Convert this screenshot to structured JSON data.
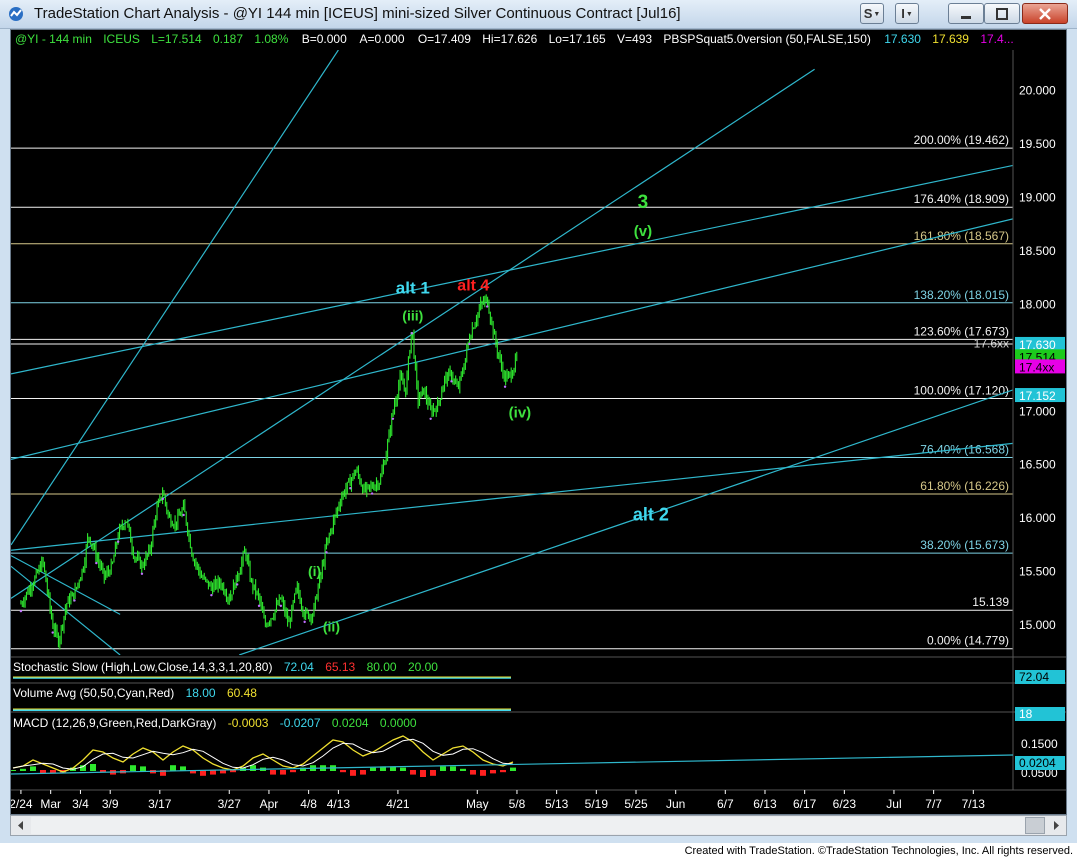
{
  "window": {
    "title": "TradeStation Chart Analysis - @YI 144 min [ICEUS] mini-sized Silver Continuous Contract [Jul16]",
    "buttons": [
      "S",
      "I"
    ],
    "credit": "Created with TradeStation. ©TradeStation Technologies, Inc. All rights reserved."
  },
  "header": {
    "symbol": "@YI - 144 min",
    "exchange": "ICEUS",
    "last": "L=17.514",
    "change": "0.187",
    "pct": "1.08%",
    "bid": "B=0.000",
    "ask": "A=0.000",
    "open": "O=17.409",
    "high": "Hi=17.626",
    "low": "Lo=17.165",
    "volume": "V=493",
    "indicator": "PBSPSquat5.0version (50,FALSE,150)",
    "ind_v1": "17.630",
    "ind_v2": "17.639",
    "ind_v3": "17.4..."
  },
  "chart_data": {
    "type": "candlestick",
    "symbol": "@YI",
    "interval": "144 min",
    "ylim": [
      14.72,
      20.38
    ],
    "y_ticks": [
      15.0,
      15.5,
      16.0,
      16.5,
      17.0,
      17.5,
      18.0,
      18.5,
      19.0,
      19.5,
      20.0
    ],
    "y_tick_labels": [
      "15.000",
      "15.500",
      "16.000",
      "16.500",
      "17.000",
      "17.500",
      "18.000",
      "18.500",
      "19.000",
      "19.500",
      "20.000"
    ],
    "x_labels": [
      "2/24",
      "Mar",
      "3/4",
      "3/9",
      "3/17",
      "3/27",
      "Apr",
      "4/8",
      "4/13",
      "4/21",
      "May",
      "5/8",
      "5/13",
      "5/19",
      "5/25",
      "Jun",
      "6/7",
      "6/13",
      "6/17",
      "6/23",
      "Jul",
      "7/7",
      "7/13"
    ],
    "x_label_day_index": [
      0,
      3,
      6,
      9,
      14,
      21,
      25,
      29,
      32,
      38,
      46,
      50,
      54,
      58,
      62,
      66,
      71,
      75,
      79,
      83,
      88,
      92,
      96
    ],
    "x_day_span": [
      -1,
      100
    ],
    "price_path": [
      [
        0,
        15.2
      ],
      [
        1.5,
        15.45
      ],
      [
        2.2,
        15.6
      ],
      [
        3.2,
        15.0
      ],
      [
        3.8,
        14.85
      ],
      [
        4.6,
        15.2
      ],
      [
        5.4,
        15.3
      ],
      [
        6.3,
        15.55
      ],
      [
        6.8,
        15.85
      ],
      [
        7.6,
        15.65
      ],
      [
        8.4,
        15.45
      ],
      [
        9.2,
        15.55
      ],
      [
        9.8,
        15.85
      ],
      [
        10.6,
        16.0
      ],
      [
        11.4,
        15.65
      ],
      [
        12.2,
        15.55
      ],
      [
        13,
        15.7
      ],
      [
        13.6,
        16.05
      ],
      [
        14.3,
        16.25
      ],
      [
        14.9,
        16.0
      ],
      [
        15.6,
        15.95
      ],
      [
        16.4,
        16.1
      ],
      [
        17.3,
        15.65
      ],
      [
        18.2,
        15.45
      ],
      [
        19.2,
        15.35
      ],
      [
        20.1,
        15.4
      ],
      [
        21,
        15.25
      ],
      [
        21.8,
        15.45
      ],
      [
        22.6,
        15.7
      ],
      [
        23.2,
        15.4
      ],
      [
        24,
        15.25
      ],
      [
        24.6,
        15.0
      ],
      [
        25.4,
        15.1
      ],
      [
        26.2,
        15.25
      ],
      [
        27,
        15.0
      ],
      [
        27.8,
        15.35
      ],
      [
        28.6,
        15.1
      ],
      [
        29.4,
        15.1
      ],
      [
        30.2,
        15.45
      ],
      [
        30.8,
        15.75
      ],
      [
        31.6,
        16.0
      ],
      [
        32.3,
        16.2
      ],
      [
        33.2,
        16.35
      ],
      [
        33.8,
        16.45
      ],
      [
        34.6,
        16.25
      ],
      [
        35.4,
        16.3
      ],
      [
        36.2,
        16.35
      ],
      [
        36.8,
        16.6
      ],
      [
        37.5,
        17.0
      ],
      [
        38.2,
        17.3
      ],
      [
        38.8,
        17.2
      ],
      [
        39.4,
        17.8
      ],
      [
        40,
        17.1
      ],
      [
        40.6,
        17.2
      ],
      [
        41.3,
        17.0
      ],
      [
        42,
        17.05
      ],
      [
        42.7,
        17.3
      ],
      [
        43.4,
        17.35
      ],
      [
        44,
        17.2
      ],
      [
        44.6,
        17.4
      ],
      [
        45.2,
        17.7
      ],
      [
        45.8,
        17.85
      ],
      [
        46.4,
        18.0
      ],
      [
        47,
        18.05
      ],
      [
        47.6,
        17.75
      ],
      [
        48.2,
        17.5
      ],
      [
        48.8,
        17.3
      ],
      [
        49.4,
        17.35
      ],
      [
        50,
        17.5
      ]
    ],
    "fib_levels": [
      {
        "price": 19.462,
        "label": "200.00% (19.462)",
        "color": "#f2f2f2"
      },
      {
        "price": 18.909,
        "label": "176.40% (18.909)",
        "color": "#f2f2f2"
      },
      {
        "price": 18.567,
        "label": "161.80% (18.567)",
        "color": "#d6c88a"
      },
      {
        "price": 18.015,
        "label": "138.20% (18.015)",
        "color": "#7ed3e5"
      },
      {
        "price": 17.673,
        "label": "123.60% (17.673)",
        "color": "#f2f2f2"
      },
      {
        "price": 17.12,
        "label": "100.00% (17.120)",
        "color": "#f2f2f2"
      },
      {
        "price": 16.568,
        "label": "76.40% (16.568)",
        "color": "#7ed3e5"
      },
      {
        "price": 16.226,
        "label": "61.80% (16.226)",
        "color": "#d6c88a"
      },
      {
        "price": 15.673,
        "label": "38.20% (15.673)",
        "color": "#7ed3e5"
      },
      {
        "price": 15.139,
        "label": "15.139",
        "color": "#f2f2f2"
      },
      {
        "price": 14.779,
        "label": "0.00% (14.779)",
        "color": "#f2f2f2"
      }
    ],
    "overlap_label": "17.6xx",
    "trendlines": [
      {
        "d0": -1,
        "p0": 15.75,
        "d1": 32,
        "p1": 20.38
      },
      {
        "d0": -1,
        "p0": 15.25,
        "d1": 80,
        "p1": 20.2
      },
      {
        "d0": -1,
        "p0": 17.35,
        "d1": 100,
        "p1": 19.3
      },
      {
        "d0": -1,
        "p0": 16.55,
        "d1": 100,
        "p1": 18.8
      },
      {
        "d0": 22,
        "p0": 14.72,
        "d1": 100,
        "p1": 17.2
      },
      {
        "d0": -1,
        "p0": 15.7,
        "d1": 100,
        "p1": 16.7
      },
      {
        "d0": -1,
        "p0": 15.55,
        "d1": 10,
        "p1": 14.72
      },
      {
        "d0": -1,
        "p0": 15.65,
        "d1": 10,
        "p1": 15.1
      }
    ],
    "annotations": [
      {
        "text": "alt 1",
        "day": 39.5,
        "price": 18.1,
        "color": "#3fd8ee",
        "size": 17
      },
      {
        "text": "alt 4",
        "day": 45.6,
        "price": 18.13,
        "color": "#ff2020",
        "size": 16
      },
      {
        "text": "(iii)",
        "day": 39.5,
        "price": 17.85,
        "color": "#3ee13e",
        "size": 14
      },
      {
        "text": "3",
        "day": 62.7,
        "price": 18.9,
        "color": "#3ee13e",
        "size": 19
      },
      {
        "text": "(v)",
        "day": 62.7,
        "price": 18.64,
        "color": "#3ee13e",
        "size": 15
      },
      {
        "text": "(iv)",
        "day": 50.3,
        "price": 16.94,
        "color": "#3ee13e",
        "size": 15
      },
      {
        "text": "alt 2",
        "day": 63.5,
        "price": 15.98,
        "color": "#3fd8ee",
        "size": 18
      },
      {
        "text": "(i)",
        "day": 29.6,
        "price": 15.46,
        "color": "#3ee13e",
        "size": 14
      },
      {
        "text": "(ii)",
        "day": 31.3,
        "price": 14.94,
        "color": "#3ee13e",
        "size": 14
      }
    ],
    "price_badges": [
      {
        "text": "17.630",
        "bg": "#22c3d6",
        "fg": "#ffffff",
        "price": 17.63
      },
      {
        "text": "17.514",
        "bg": "#1ccb1c",
        "fg": "#000000",
        "price": 17.514
      },
      {
        "text": "17.4xx",
        "bg": "#e600e6",
        "fg": "#000000",
        "price": 17.42
      },
      {
        "text": "17.152",
        "bg": "#22c3d6",
        "fg": "#ffffff",
        "price": 17.152
      }
    ]
  },
  "stochastic": {
    "label": "Stochastic Slow (High,Low,Close,14,3,3,1,20,80)",
    "v1": "72.04",
    "v2": "65.13",
    "v3": "80.00",
    "v4": "20.00",
    "badge": "72.04"
  },
  "volume": {
    "label": "Volume Avg (50,50,Cyan,Red)",
    "v1": "18.00",
    "v2": "60.48",
    "badge": "18"
  },
  "macd": {
    "label": "MACD (12,26,9,Green,Red,DarkGray)",
    "v1": "-0.0003",
    "v2": "-0.0207",
    "v3": "0.0204",
    "v4": "0.0000",
    "tick1": "0.1500",
    "tick2": "0.0500",
    "badge": "0.0204",
    "series": [
      0.02,
      0.03,
      0.06,
      0.04,
      0.02,
      0.0,
      0.02,
      0.06,
      0.11,
      0.1,
      0.07,
      0.05,
      0.09,
      0.12,
      0.1,
      0.06,
      0.1,
      0.13,
      0.11,
      0.07,
      0.04,
      0.02,
      0.01,
      0.03,
      0.07,
      0.09,
      0.06,
      0.03,
      0.02,
      0.04,
      0.08,
      0.12,
      0.16,
      0.15,
      0.11,
      0.08,
      0.1,
      0.13,
      0.16,
      0.18,
      0.15,
      0.1,
      0.06,
      0.09,
      0.12,
      0.13,
      0.1,
      0.06,
      0.04,
      0.03,
      0.05
    ]
  }
}
